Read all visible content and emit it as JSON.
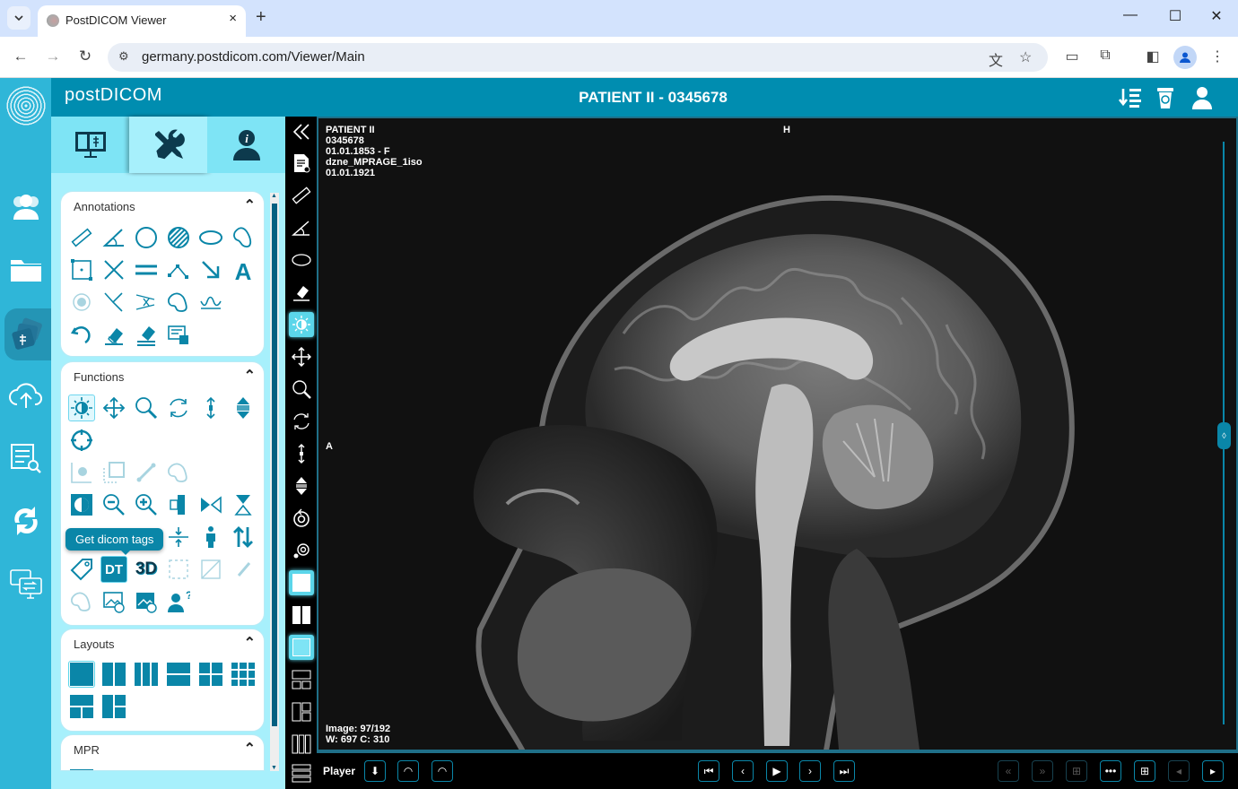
{
  "browser": {
    "tab_title": "PostDICOM Viewer",
    "url": "germany.postdicom.com/Viewer/Main",
    "new_tab_label": "+",
    "close_tab_label": "×"
  },
  "app": {
    "brand": "postDICOM",
    "patient_title": "PATIENT II - 0345678",
    "header_icons": [
      "sort-list-icon",
      "recycle-bin-icon",
      "user-icon"
    ]
  },
  "rail": {
    "items": [
      "patients-icon",
      "folder-icon",
      "viewer-images-icon",
      "upload-cloud-icon",
      "search-list-icon",
      "sync-icon",
      "screens-transfer-icon"
    ],
    "active": "viewer-images-icon"
  },
  "panel": {
    "tabs": [
      "viewer-tab",
      "tools-tab",
      "patient-info-tab"
    ],
    "active_tab": "tools-tab",
    "sections": {
      "annotations": {
        "title": "Annotations"
      },
      "functions": {
        "title": "Functions"
      },
      "layouts": {
        "title": "Layouts"
      },
      "mpr": {
        "title": "MPR"
      }
    },
    "tooltip": "Get dicom tags",
    "dt_label": "DT",
    "threed_label": "3D"
  },
  "viewer": {
    "overlay_top_left": [
      "PATIENT II",
      "0345678",
      "01.01.1853 - F",
      "dzne_MPRAGE_1iso",
      "01.01.1921"
    ],
    "orientation_top": "H",
    "orientation_left": "A",
    "image_index": "Image: 97/192",
    "window_level": "W: 697 C: 310",
    "slice_current": 97,
    "slice_total": 192
  },
  "player": {
    "label": "Player"
  },
  "colors": {
    "brand": "#008db0",
    "rail": "#2fb6d8",
    "panel": "#a7f0fc",
    "accent": "#0a86a8",
    "highlight": "#5bd6ea"
  }
}
